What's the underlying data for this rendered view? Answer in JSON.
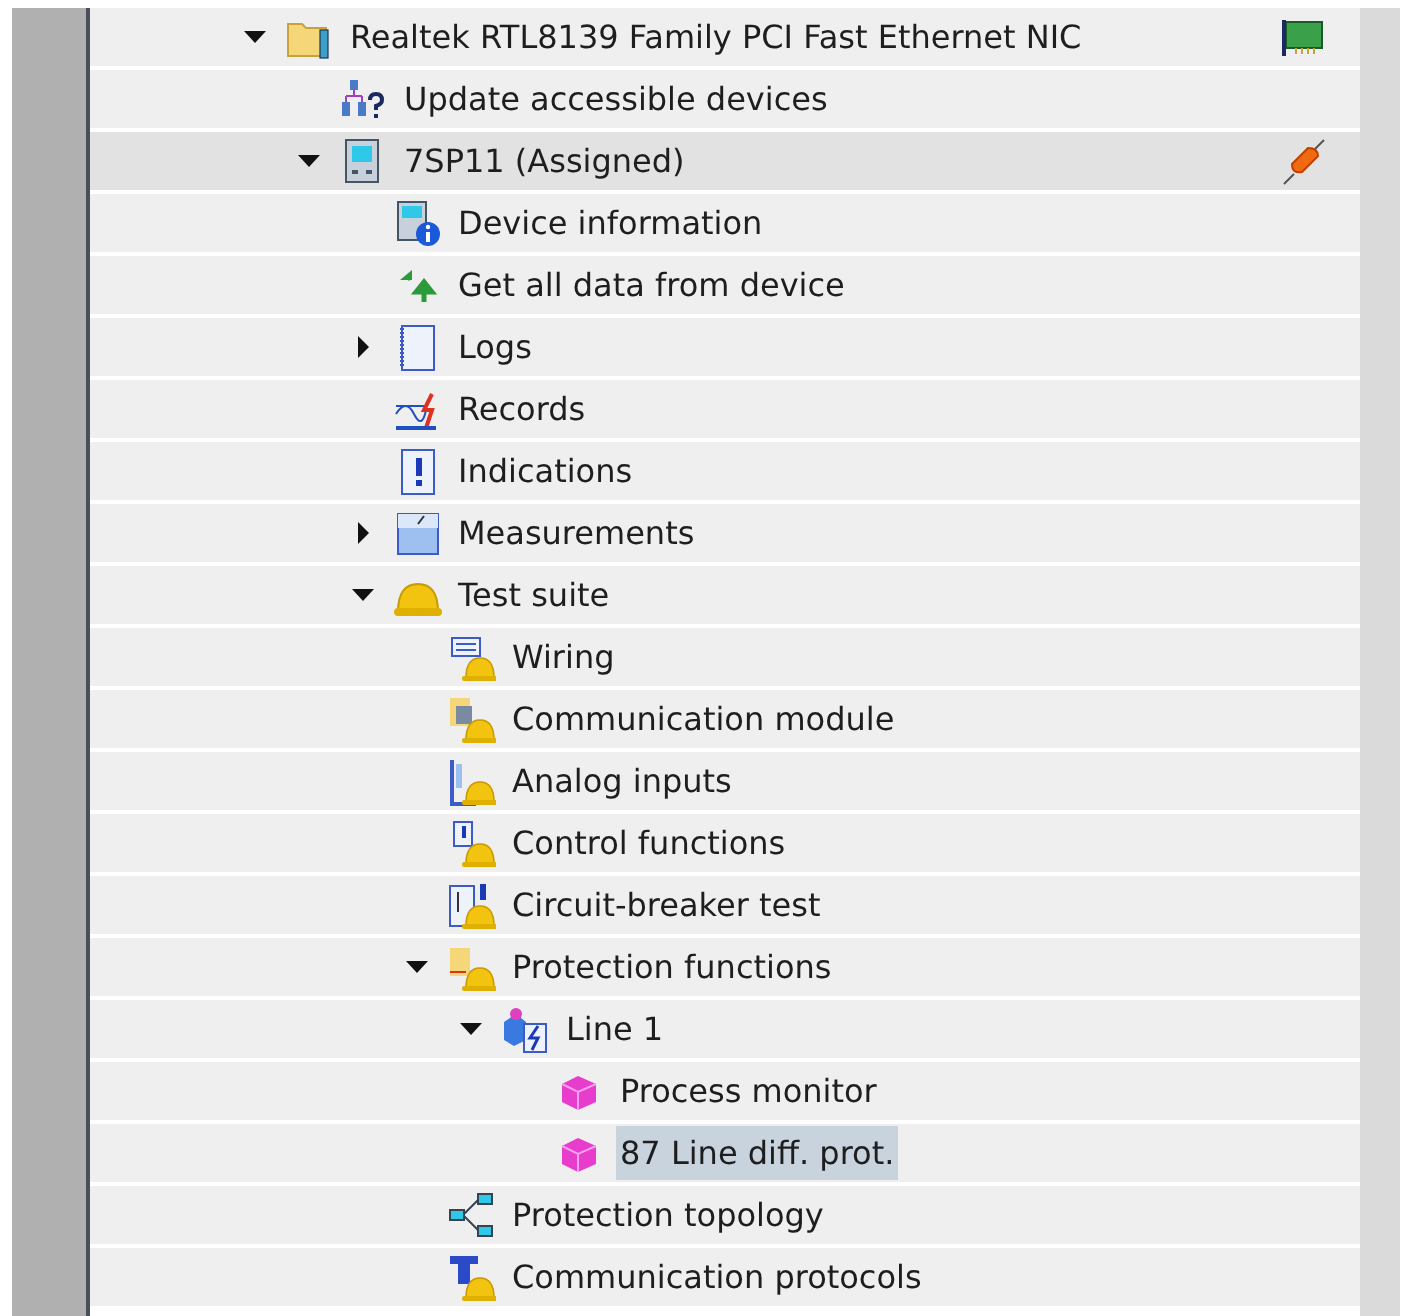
{
  "tree": [
    {
      "label": "Realtek RTL8139 Family PCI Fast Ethernet NIC",
      "kind": "node",
      "expanded": true,
      "selected": false,
      "highlighted": false,
      "children": [
        {
          "label": "Update accessible devices",
          "kind": "leaf",
          "selected": false,
          "highlighted": false
        },
        {
          "label": "7SP11 (Assigned)",
          "kind": "node",
          "expanded": true,
          "selected": false,
          "highlighted": true,
          "children": [
            {
              "label": "Device information",
              "kind": "leaf",
              "selected": false,
              "highlighted": false
            },
            {
              "label": "Get all data from device",
              "kind": "leaf",
              "selected": false,
              "highlighted": false
            },
            {
              "label": "Logs",
              "kind": "node",
              "expanded": false,
              "selected": false,
              "highlighted": false
            },
            {
              "label": "Records",
              "kind": "leaf",
              "selected": false,
              "highlighted": false
            },
            {
              "label": "Indications",
              "kind": "leaf",
              "selected": false,
              "highlighted": false
            },
            {
              "label": "Measurements",
              "kind": "node",
              "expanded": false,
              "selected": false,
              "highlighted": false
            },
            {
              "label": "Test suite",
              "kind": "node",
              "expanded": true,
              "selected": false,
              "highlighted": false,
              "children": [
                {
                  "label": "Wiring",
                  "kind": "leaf",
                  "selected": false,
                  "highlighted": false
                },
                {
                  "label": "Communication module",
                  "kind": "leaf",
                  "selected": false,
                  "highlighted": false
                },
                {
                  "label": "Analog inputs",
                  "kind": "leaf",
                  "selected": false,
                  "highlighted": false
                },
                {
                  "label": "Control functions",
                  "kind": "leaf",
                  "selected": false,
                  "highlighted": false
                },
                {
                  "label": "Circuit-breaker test",
                  "kind": "leaf",
                  "selected": false,
                  "highlighted": false
                },
                {
                  "label": "Protection functions",
                  "kind": "node",
                  "expanded": true,
                  "selected": false,
                  "highlighted": false,
                  "children": [
                    {
                      "label": "Line 1",
                      "kind": "node",
                      "expanded": true,
                      "selected": false,
                      "highlighted": false,
                      "children": [
                        {
                          "label": "Process monitor",
                          "kind": "leaf",
                          "selected": false,
                          "highlighted": false
                        },
                        {
                          "label": "87 Line diff. prot.",
                          "kind": "leaf",
                          "selected": true,
                          "highlighted": false
                        }
                      ]
                    }
                  ]
                },
                {
                  "label": "Protection topology",
                  "kind": "leaf",
                  "selected": false,
                  "highlighted": false
                },
                {
                  "label": "Communication protocols",
                  "kind": "leaf",
                  "selected": false,
                  "highlighted": false
                }
              ]
            }
          ]
        }
      ]
    }
  ]
}
